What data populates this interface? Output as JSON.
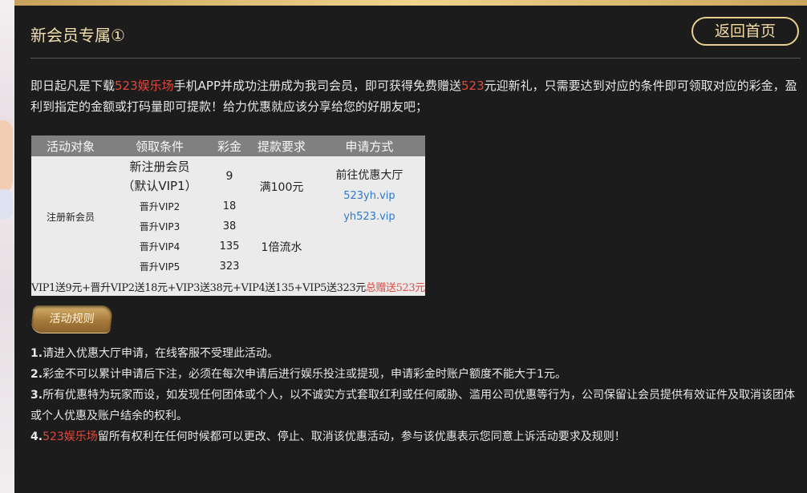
{
  "colors": {
    "accent_gold": "#f0d48e",
    "accent_red": "#e2483d",
    "panel_bg": "#1c1c1c",
    "link_blue": "#2f79c8"
  },
  "header": {
    "title": "新会员专属①",
    "back_button": "返回首页"
  },
  "intro": {
    "p1": "即日起凡是下载",
    "brand": "523娱乐场",
    "p2": "手机APP并成功注册成为我司会员，即可获得免费赠送",
    "amount": "523",
    "p3": "元迎新礼，只需要达到对应的条件即可领取对应的彩金，盈利到指定的金额或打码量即可提款！给力优惠就应该分享给您的好朋友吧；"
  },
  "table": {
    "headers": [
      "活动对象",
      "领取条件",
      "彩金",
      "提款要求",
      "申请方式"
    ],
    "target": "注册新会员",
    "rows": [
      {
        "condition_line1": "新注册会员",
        "condition_line2": "（默认VIP1）",
        "bonus": "9"
      },
      {
        "condition": "晋升VIP2",
        "bonus": "18"
      },
      {
        "condition": "晋升VIP3",
        "bonus": "38"
      },
      {
        "condition": "晋升VIP4",
        "bonus": "135"
      },
      {
        "condition": "晋升VIP5",
        "bonus": "323"
      }
    ],
    "withdraw_1": "满100元",
    "withdraw_2": "1倍流水",
    "apply_text": "前往优惠大厅",
    "apply_links": [
      "523yh.vip",
      "yh523.vip"
    ],
    "summary_main": "VIP1送9元+晋升VIP2送18元+VIP3送38元+VIP4送135+VIP5送323元",
    "summary_total": "总赠送523元"
  },
  "rules_badge": "活动规则",
  "rules": [
    {
      "num": "1.",
      "text": "请进入优惠大厅申请，在线客服不受理此活动。"
    },
    {
      "num": "2.",
      "text": "彩金不可以累计申请后下注，必须在每次申请后进行娱乐投注或提现，申请彩金时账户额度不能大于1元。"
    },
    {
      "num": "3.",
      "text": "所有优惠特为玩家而设，如发现任何团体或个人，以不诚实方式套取红利或任何威胁、滥用公司优惠等行为，公司保留让会员提供有效证件及取消该团体或个人优惠及账户结余的权利。"
    },
    {
      "num": "4.",
      "brand": "523娱乐场",
      "text": "留所有权利在任何时候都可以更改、停止、取消该优惠活动，参与该优惠表示您同意上诉活动要求及规则！"
    }
  ]
}
